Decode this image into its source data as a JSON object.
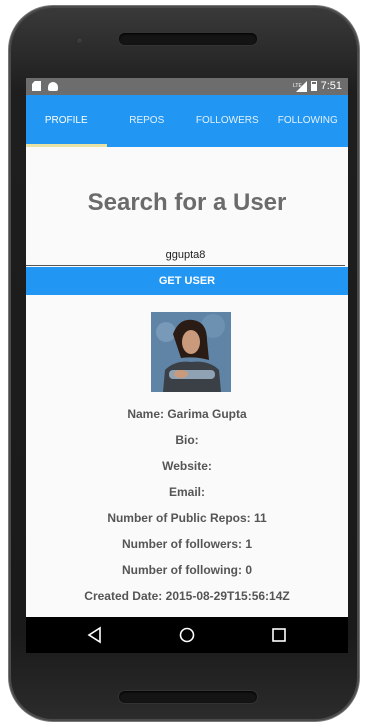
{
  "status_bar": {
    "time": "7:51",
    "signal_label": "LTE"
  },
  "tabs": [
    {
      "label": "PROFILE",
      "active": true
    },
    {
      "label": "REPOS",
      "active": false
    },
    {
      "label": "FOLLOWERS",
      "active": false
    },
    {
      "label": "FOLLOWING",
      "active": false
    }
  ],
  "search": {
    "title": "Search for a User",
    "value": "ggupta8",
    "button_label": "GET USER"
  },
  "profile": {
    "name_line": "Name: Garima Gupta",
    "bio_line": "Bio:",
    "website_line": "Website:",
    "email_line": "Email:",
    "public_repos_line": "Number of Public Repos: 11",
    "followers_line": "Number of followers: 1",
    "following_line": "Number of following: 0",
    "created_line": "Created Date: 2015-08-29T15:56:14Z"
  },
  "colors": {
    "primary": "#2196f3",
    "tab_indicator": "#e8e3a4",
    "status_bar": "#6d6d6d",
    "title_text": "#6b6b6b"
  },
  "icons": {
    "nav_back": "triangle-back-icon",
    "nav_home": "circle-home-icon",
    "nav_recent": "square-recent-icon"
  }
}
